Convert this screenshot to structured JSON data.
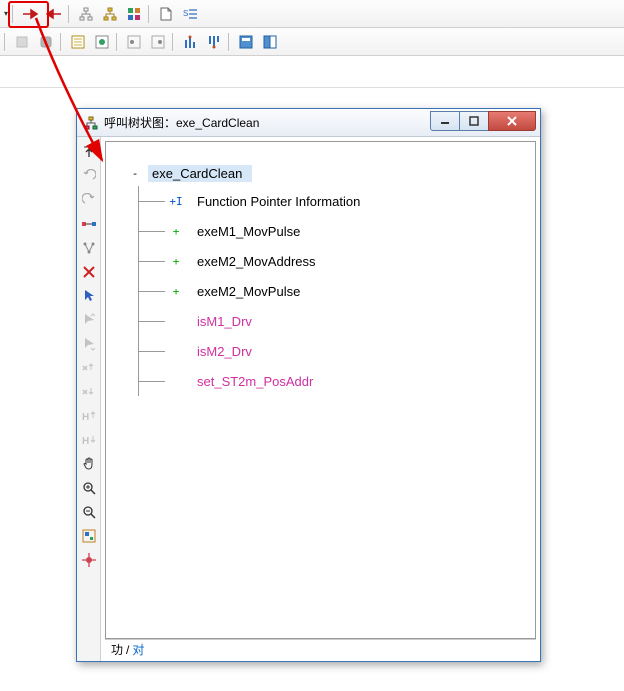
{
  "toolbars": {
    "row1": [
      "dropdown",
      "call-out",
      "call-in",
      "tool-a",
      "tool-b",
      "tool-c",
      "doc-icon",
      "text-list"
    ],
    "row2": [
      "grip",
      "box1",
      "box2",
      "list",
      "record",
      "nav-prev",
      "nav-next",
      "vbar-up",
      "vbar-down",
      "panel-blue",
      "panel-toggle"
    ]
  },
  "dialog": {
    "title": "呼叫树状图：exe_CardClean",
    "window_buttons": {
      "min": "minimize",
      "max": "maximize",
      "close": "close"
    }
  },
  "side_tools": [
    {
      "name": "up-exit",
      "disabled": false
    },
    {
      "name": "undo",
      "disabled": true
    },
    {
      "name": "redo",
      "disabled": true
    },
    {
      "name": "find-pair",
      "disabled": false
    },
    {
      "name": "auto-layout",
      "disabled": false
    },
    {
      "name": "delete",
      "disabled": false
    },
    {
      "name": "pointer",
      "disabled": false
    },
    {
      "name": "arrow-up",
      "disabled": true
    },
    {
      "name": "arrow-down",
      "disabled": true
    },
    {
      "name": "x-up",
      "disabled": true
    },
    {
      "name": "x-down",
      "disabled": true
    },
    {
      "name": "h-up",
      "disabled": true
    },
    {
      "name": "h-down",
      "disabled": true
    },
    {
      "name": "hand",
      "disabled": false
    },
    {
      "name": "zoom-in",
      "disabled": false
    },
    {
      "name": "zoom-out",
      "disabled": false
    },
    {
      "name": "overview",
      "disabled": false
    },
    {
      "name": "crosshair",
      "disabled": false
    }
  ],
  "tree": {
    "root": {
      "toggle": "-",
      "label": "exe_CardClean",
      "color": "black"
    },
    "children": [
      {
        "toggle": "+I",
        "label": "Function Pointer Information",
        "color": "black"
      },
      {
        "toggle": "+",
        "label": "exeM1_MovPulse",
        "color": "black"
      },
      {
        "toggle": "+",
        "label": "exeM2_MovAddress",
        "color": "black"
      },
      {
        "toggle": "+",
        "label": "exeM2_MovPulse",
        "color": "black"
      },
      {
        "toggle": "",
        "label": "isM1_Drv",
        "color": "magenta"
      },
      {
        "toggle": "",
        "label": "isM2_Drv",
        "color": "magenta"
      },
      {
        "toggle": "",
        "label": "set_ST2m_PosAddr",
        "color": "magenta"
      }
    ]
  },
  "status": {
    "left": "功",
    "sep": "/",
    "right": "对"
  }
}
